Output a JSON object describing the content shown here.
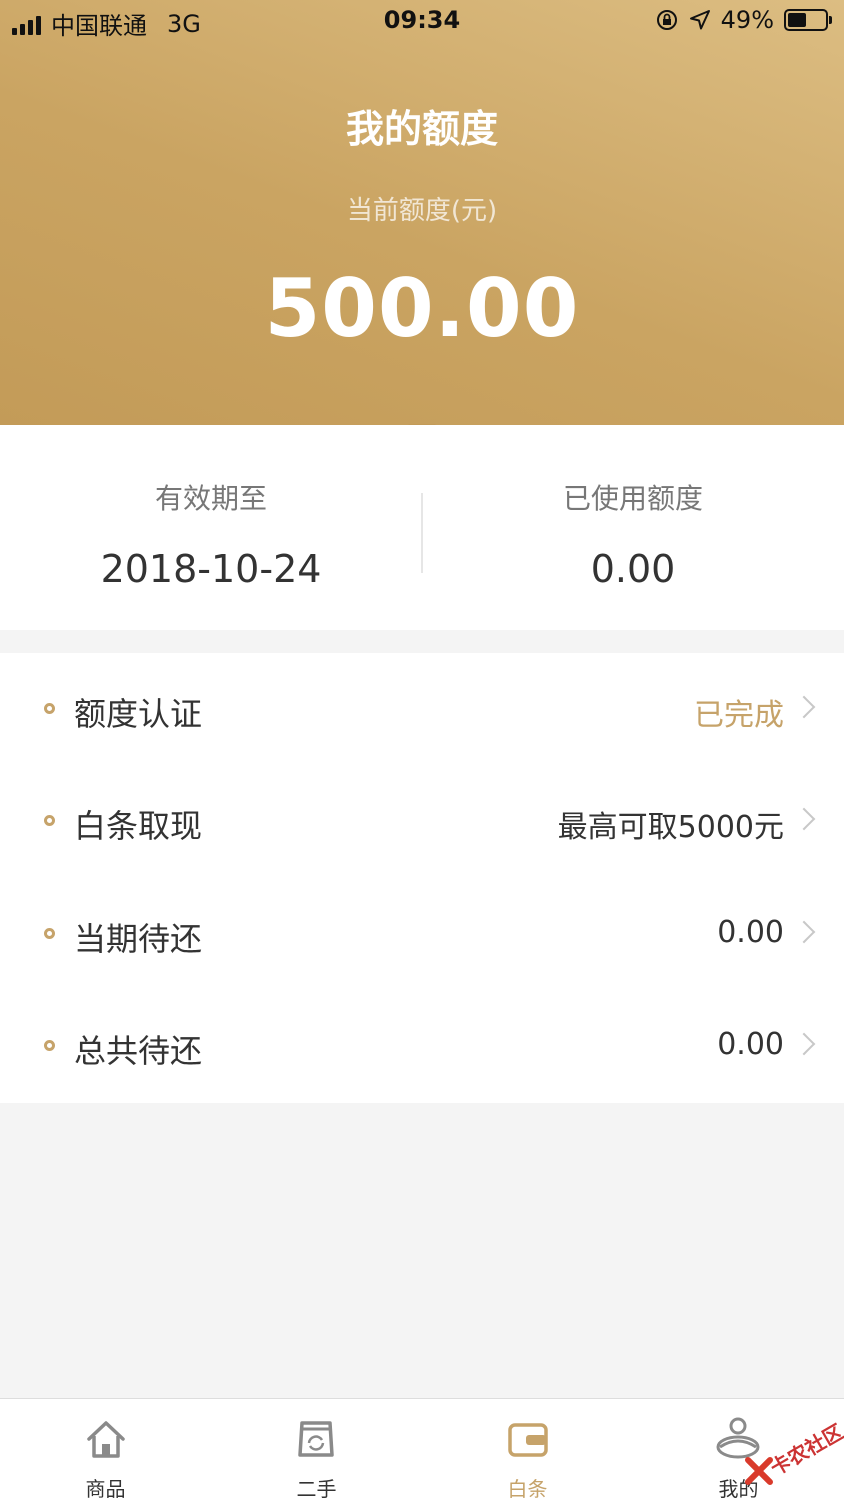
{
  "status_bar": {
    "carrier": "中国联通",
    "network": "3G",
    "time": "09:34",
    "battery": "49%",
    "battery_level": 0.49
  },
  "header": {
    "title": "我的额度",
    "subtitle": "当前额度(元)",
    "amount": "500.00"
  },
  "summary": {
    "valid_until_label": "有效期至",
    "valid_until_value": "2018-10-24",
    "used_label": "已使用额度",
    "used_value": "0.00"
  },
  "menu": {
    "items": [
      {
        "label": "额度认证",
        "value": "已完成"
      },
      {
        "label": "白条取现",
        "value": "最高可取5000元"
      },
      {
        "label": "当期待还",
        "value": "0.00"
      },
      {
        "label": "总共待还",
        "value": "0.00"
      }
    ]
  },
  "tabbar": {
    "tabs": [
      {
        "label": "商品",
        "icon": "home-icon"
      },
      {
        "label": "二手",
        "icon": "bag-icon"
      },
      {
        "label": "白条",
        "icon": "wallet-icon"
      },
      {
        "label": "我的",
        "icon": "user-icon"
      }
    ],
    "active_index": 2
  },
  "watermark": {
    "text": "卡农社区"
  },
  "colors": {
    "accent": "#c6a36a",
    "header_light": "#dcbd82",
    "header_dark": "#c39b58"
  }
}
